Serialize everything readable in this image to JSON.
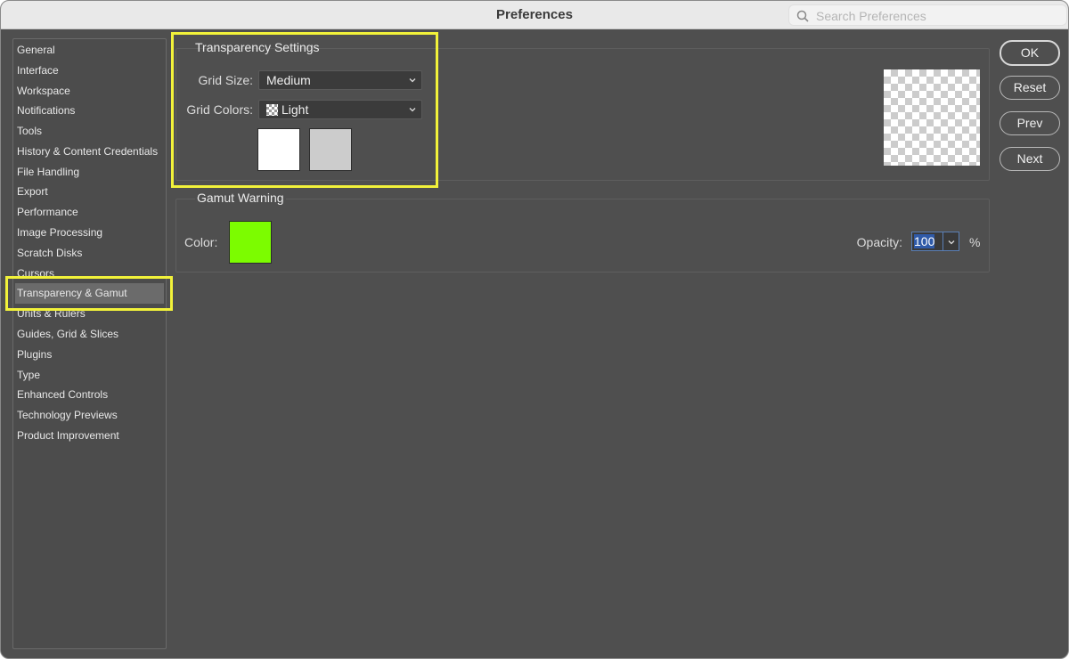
{
  "window": {
    "title": "Preferences"
  },
  "search": {
    "placeholder": "Search Preferences"
  },
  "sidebar": {
    "items": [
      {
        "label": "General"
      },
      {
        "label": "Interface"
      },
      {
        "label": "Workspace"
      },
      {
        "label": "Notifications"
      },
      {
        "label": "Tools"
      },
      {
        "label": "History & Content Credentials"
      },
      {
        "label": "File Handling"
      },
      {
        "label": "Export"
      },
      {
        "label": "Performance"
      },
      {
        "label": "Image Processing"
      },
      {
        "label": "Scratch Disks"
      },
      {
        "label": "Cursors"
      },
      {
        "label": "Transparency & Gamut"
      },
      {
        "label": "Units & Rulers"
      },
      {
        "label": "Guides, Grid & Slices"
      },
      {
        "label": "Plugins"
      },
      {
        "label": "Type"
      },
      {
        "label": "Enhanced Controls"
      },
      {
        "label": "Technology Previews"
      },
      {
        "label": "Product Improvement"
      }
    ],
    "selected": "Transparency & Gamut"
  },
  "transparency": {
    "title": "Transparency Settings",
    "grid_size_label": "Grid Size:",
    "grid_size_value": "Medium",
    "grid_colors_label": "Grid Colors:",
    "grid_colors_value": "Light",
    "swatch_1_color": "#ffffff",
    "swatch_2_color": "#cccccc"
  },
  "gamut": {
    "title": "Gamut Warning",
    "color_label": "Color:",
    "color_value": "#7cfc00",
    "opacity_label": "Opacity:",
    "opacity_value": "100",
    "opacity_unit": "%"
  },
  "buttons": {
    "ok": "OK",
    "reset": "Reset",
    "prev": "Prev",
    "next": "Next"
  },
  "colors": {
    "highlight": "#f2f23a",
    "panel_bg": "#4f4f4f",
    "selected_item": "#6b6b6b"
  }
}
